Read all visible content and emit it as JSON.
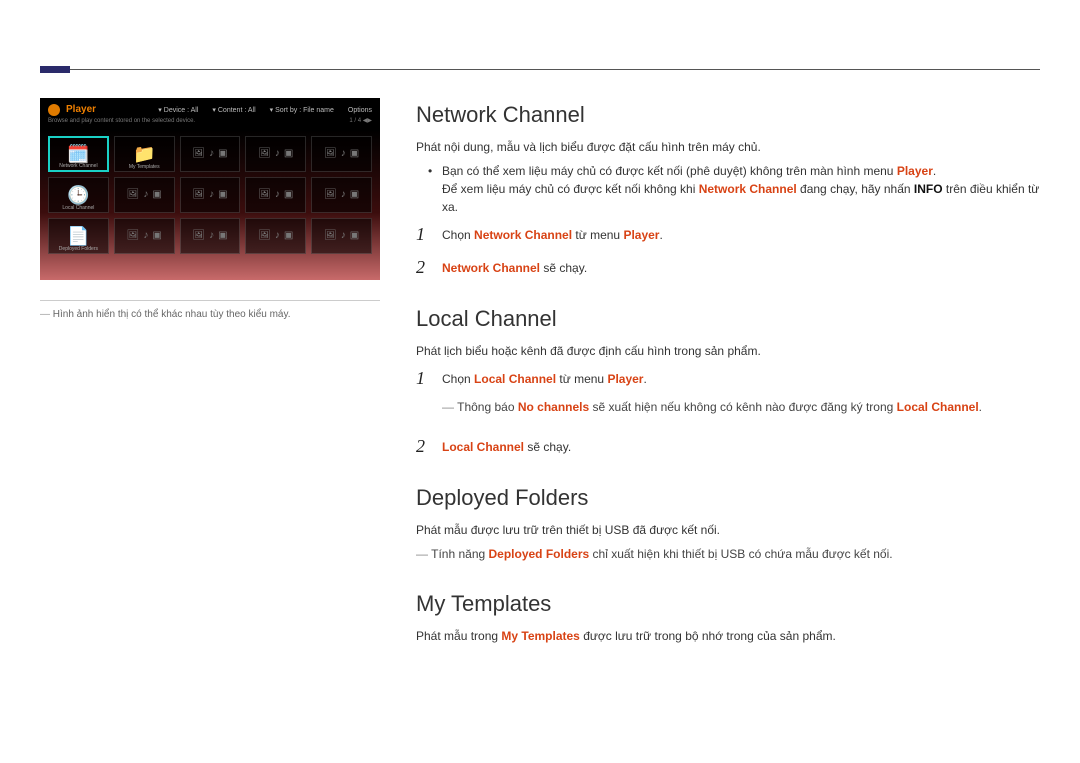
{
  "left_panel": {
    "caption": "Hình ảnh hiển thị có thể khác nhau tùy theo kiểu máy.",
    "ss": {
      "title": "Player",
      "filter_device_label": "Device :",
      "filter_device_value": "All",
      "filter_content_label": "Content :",
      "filter_content_value": "All",
      "filter_sort_label": "Sort by :",
      "filter_sort_value": "File name",
      "options_label": "Options",
      "sub_left": "Browse and play content stored on the selected device.",
      "sub_right": "1 / 4 ◀▶",
      "tiles": {
        "network_channel": "Network Channel",
        "my_templates": "My Templates",
        "local_channel": "Local Channel",
        "deployed_folders": "Deployed Folders"
      }
    }
  },
  "sections": {
    "network_channel": {
      "heading": "Network Channel",
      "intro": "Phát nội dung, mẫu và lịch biểu được đặt cấu hình trên máy chủ.",
      "bullet1_a": "Bạn có thể xem liệu máy chủ có được kết nối (phê duyệt) không trên màn hình menu ",
      "bullet1_b": "Player",
      "bullet1_c": ".",
      "bullet2_a": "Để xem liệu máy chủ có được kết nối không khi ",
      "bullet2_b": "Network Channel",
      "bullet2_c": " đang chạy, hãy nhấn ",
      "bullet2_d": "INFO",
      "bullet2_e": " trên điều khiển từ xa.",
      "step1_a": "Chọn ",
      "step1_b": "Network Channel",
      "step1_c": " từ menu ",
      "step1_d": "Player",
      "step1_e": ".",
      "step2_a": "Network Channel",
      "step2_b": " sẽ chạy."
    },
    "local_channel": {
      "heading": "Local Channel",
      "intro": "Phát lịch biểu hoặc kênh đã được định cấu hình trong sản phẩm.",
      "step1_a": "Chọn ",
      "step1_b": "Local Channel",
      "step1_c": " từ menu ",
      "step1_d": "Player",
      "step1_e": ".",
      "note_a": "Thông báo ",
      "note_b": "No channels",
      "note_c": " sẽ xuất hiện nếu không có kênh nào được đăng ký trong ",
      "note_d": "Local Channel",
      "note_e": ".",
      "step2_a": "Local Channel",
      "step2_b": " sẽ chạy."
    },
    "deployed_folders": {
      "heading": "Deployed Folders",
      "intro": "Phát mẫu được lưu trữ trên thiết bị USB đã được kết nối.",
      "note_a": "Tính năng ",
      "note_b": "Deployed Folders",
      "note_c": " chỉ xuất hiện khi thiết bị USB có chứa mẫu được kết nối."
    },
    "my_templates": {
      "heading": "My Templates",
      "intro_a": "Phát mẫu trong ",
      "intro_b": "My Templates",
      "intro_c": " được lưu trữ trong bộ nhớ trong của sản phẩm."
    }
  }
}
